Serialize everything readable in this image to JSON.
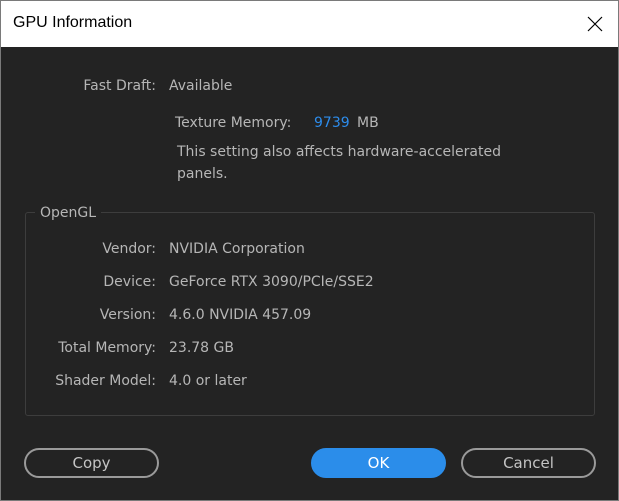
{
  "window": {
    "title": "GPU Information",
    "close_icon": "close-icon"
  },
  "fast_draft": {
    "label": "Fast Draft:",
    "value": "Available"
  },
  "texture_memory": {
    "label": "Texture Memory:",
    "value": "9739",
    "unit": "MB",
    "note": "This setting also affects hardware-accelerated panels."
  },
  "opengl": {
    "title": "OpenGL",
    "rows": [
      {
        "label": "Vendor:",
        "value": "NVIDIA Corporation"
      },
      {
        "label": "Device:",
        "value": "GeForce RTX 3090/PCIe/SSE2"
      },
      {
        "label": "Version:",
        "value": "4.6.0 NVIDIA 457.09"
      },
      {
        "label": "Total Memory:",
        "value": "23.78 GB"
      },
      {
        "label": "Shader Model:",
        "value": "4.0 or later"
      }
    ]
  },
  "buttons": {
    "copy": "Copy",
    "ok": "OK",
    "cancel": "Cancel"
  },
  "colors": {
    "background": "#232323",
    "accent": "#2b8dea",
    "text": "#b6b6b6"
  }
}
